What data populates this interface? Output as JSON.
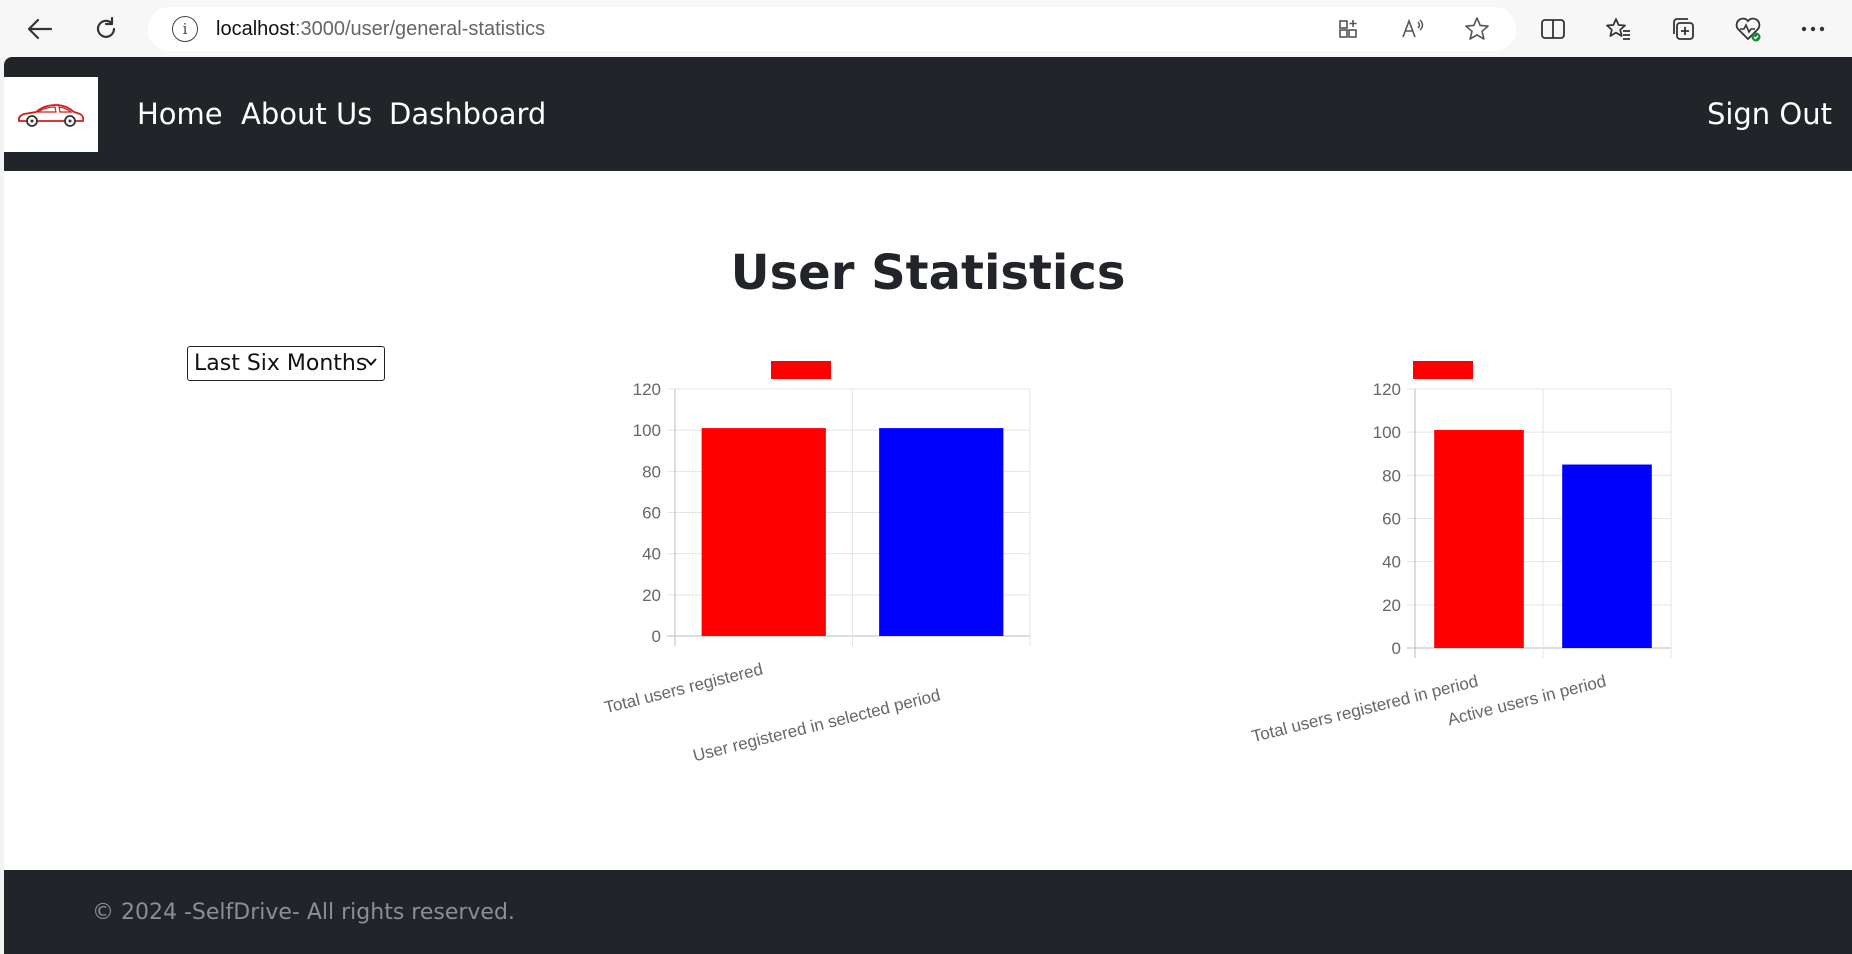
{
  "browser": {
    "url_host": "localhost",
    "url_path": ":3000/user/general-statistics"
  },
  "navbar": {
    "links": [
      "Home",
      "About Us",
      "Dashboard"
    ],
    "sign_out": "Sign Out"
  },
  "page": {
    "title": "User Statistics",
    "period_select": {
      "selected": "Last Six Months"
    }
  },
  "chart_data": [
    {
      "type": "bar",
      "categories": [
        "Total users registered",
        "User registered in selected period"
      ],
      "values": [
        101,
        101
      ],
      "colors": [
        "#ff0000",
        "#0000ff"
      ],
      "ylim": [
        0,
        120
      ],
      "yticks": [
        0,
        20,
        40,
        60,
        80,
        100,
        120
      ],
      "legend": {
        "color": "#ff0000",
        "label": "",
        "placement": "top"
      },
      "grid": true
    },
    {
      "type": "bar",
      "categories": [
        "Total users registered in period",
        "Active users in period"
      ],
      "values": [
        101,
        85
      ],
      "colors": [
        "#ff0000",
        "#0000ff"
      ],
      "ylim": [
        0,
        120
      ],
      "yticks": [
        0,
        20,
        40,
        60,
        80,
        100,
        120
      ],
      "legend": {
        "color": "#ff0000",
        "label": "",
        "placement": "top"
      },
      "grid": true
    }
  ],
  "footer": {
    "text": "© 2024 -SelfDrive- All rights reserved."
  }
}
